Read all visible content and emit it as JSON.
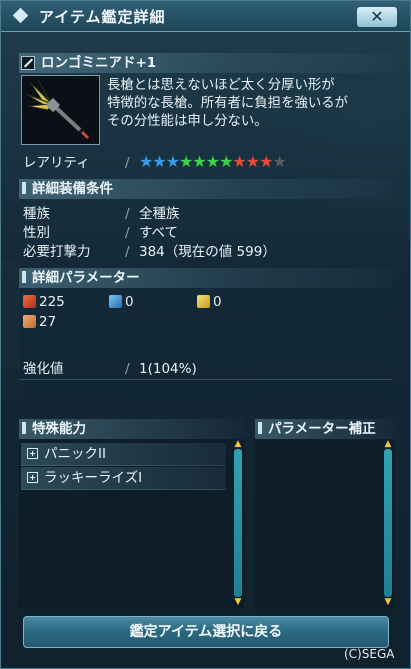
{
  "window": {
    "title": "アイテム鑑定詳細",
    "close_label": "✕"
  },
  "item": {
    "name": "ロンゴミニアド+1",
    "description": [
      "長槍とは思えないほど太く分厚い形が",
      "特徴的な長槍。所有者に負担を強いるが",
      "その分性能は申し分ない。"
    ],
    "rarity_label": "レアリティ",
    "rarity_stars": 10,
    "rarity_max": 11
  },
  "requirements": {
    "header": "詳細装備条件",
    "race_label": "種族",
    "race_value": "全種族",
    "gender_label": "性別",
    "gender_value": "すべて",
    "power_label": "必要打撃力",
    "power_value": "384（現在の値 599）"
  },
  "parameters": {
    "header": "詳細パラメーター",
    "attack": "225",
    "shoot": "0",
    "tech": "0",
    "dex": "27"
  },
  "grind": {
    "label": "強化値",
    "value": "1(104%)"
  },
  "abilities": {
    "header": "特殊能力",
    "items": [
      "パニックII",
      "ラッキーライズI"
    ]
  },
  "param_correction": {
    "header": "パラメーター補正"
  },
  "bottom_button": "鑑定アイテム選択に戻る",
  "copyright": "(C)SEGA",
  "colors": {
    "star_blue": "#3a9be8",
    "star_green": "#3fd14a",
    "star_red": "#e84a3a",
    "star_empty": "#555d62",
    "scroll_arrow": "#f0c640"
  }
}
